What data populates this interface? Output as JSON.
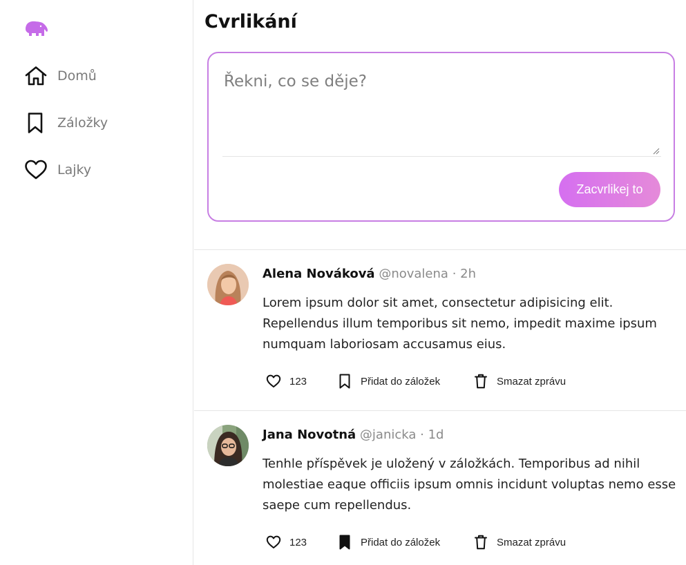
{
  "sidebar": {
    "logo": "elephant-logo",
    "items": [
      {
        "label": "Domů",
        "icon": "home-icon"
      },
      {
        "label": "Záložky",
        "icon": "bookmark-icon"
      },
      {
        "label": "Lajky",
        "icon": "heart-icon"
      }
    ]
  },
  "main": {
    "title": "Cvrlikání",
    "composer": {
      "placeholder": "Řekni, co se děje?",
      "value": "",
      "submit_label": "Zacvrlikej to"
    },
    "posts": [
      {
        "author": "Alena Nováková",
        "handle": "@novalena",
        "separator": "·",
        "time": "2h",
        "text": "Lorem ipsum dolor sit amet, consectetur adipisicing elit. Repellendus illum temporibus sit nemo, impedit maxime ipsum numquam laboriosam accusamus eius.",
        "likes": "123",
        "bookmark_label": "Přidat do záložek",
        "bookmarked": false,
        "delete_label": "Smazat zprávu"
      },
      {
        "author": "Jana Novotná",
        "handle": "@janicka",
        "separator": "·",
        "time": "1d",
        "text": "Tenhle příspěvek je uložený v záložkách. Temporibus ad nihil molestiae eaque officiis ipsum omnis incidunt voluptas nemo esse saepe cum repellendus.",
        "likes": "123",
        "bookmark_label": "Přidat do záložek",
        "bookmarked": true,
        "delete_label": "Smazat zprávu"
      }
    ]
  },
  "colors": {
    "accent": "#c77ee3",
    "button_gradient_start": "#d56ff0",
    "button_gradient_end": "#e58ad9",
    "logo": "#c56be8"
  }
}
